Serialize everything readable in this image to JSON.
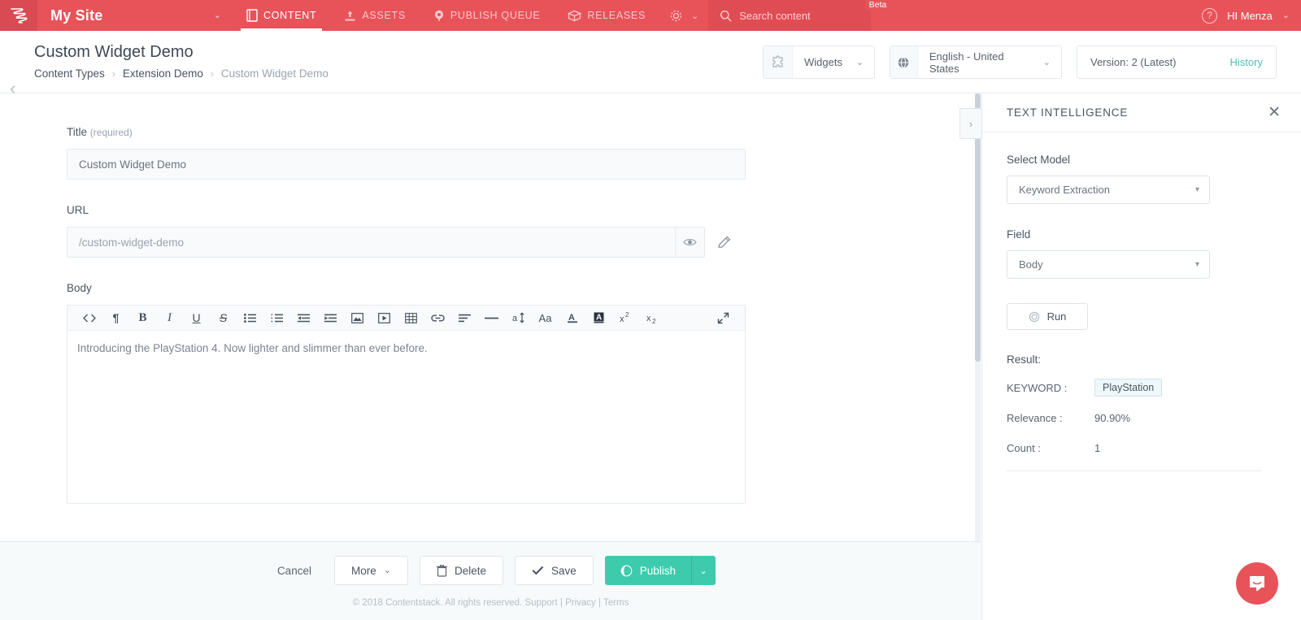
{
  "topnav": {
    "logo": "contentstack-logo-icon",
    "site_name": "My Site",
    "site_caret": "⌄",
    "items": [
      {
        "label": "CONTENT",
        "icon": "content-icon",
        "active": true
      },
      {
        "label": "ASSETS",
        "icon": "assets-upload-icon",
        "active": false
      },
      {
        "label": "PUBLISH QUEUE",
        "icon": "publish-queue-icon",
        "active": false
      },
      {
        "label": "RELEASES",
        "icon": "releases-box-icon",
        "active": false
      }
    ],
    "settings_icon": "gear-icon",
    "settings_caret": "⌄",
    "search_placeholder": "Search content",
    "search_icon": "search-icon",
    "beta_badge": "Beta",
    "help_icon": "?",
    "user_greeting": "HI  Menza",
    "user_caret": "⌄"
  },
  "header": {
    "back_icon": "‹",
    "title": "Custom Widget Demo",
    "breadcrumb": [
      {
        "label": "Content Types",
        "current": false
      },
      {
        "label": "Extension Demo",
        "current": false
      },
      {
        "label": "Custom Widget Demo",
        "current": true
      }
    ],
    "breadcrumb_sep": "›",
    "widgets": {
      "icon": "puzzle-piece-icon",
      "label": "Widgets",
      "caret": "⌄"
    },
    "locale": {
      "icon": "globe-icon",
      "label": "English - United States",
      "caret": "⌄"
    },
    "version": {
      "text": "Version: 2 (Latest)",
      "history_label": "History"
    }
  },
  "form": {
    "title_field": {
      "label": "Title",
      "required_note": "(required)",
      "value": "Custom Widget Demo"
    },
    "url_field": {
      "label": "URL",
      "value": "/custom-widget-demo",
      "eye_icon": "eye-icon",
      "pencil_icon": "pencil-edit-icon"
    },
    "body_field": {
      "label": "Body",
      "content": "Introducing the PlayStation 4. Now lighter and slimmer than ever before.",
      "toolbar": [
        {
          "name": "code-icon",
          "glyph": "<>"
        },
        {
          "name": "paragraph-mark-icon",
          "glyph": "¶"
        },
        {
          "name": "bold-icon",
          "glyph": "B"
        },
        {
          "name": "italic-icon",
          "glyph": "I"
        },
        {
          "name": "underline-icon",
          "glyph": "U"
        },
        {
          "name": "strikethrough-icon",
          "glyph": "S"
        },
        {
          "name": "bulleted-list-icon",
          "glyph": ""
        },
        {
          "name": "numbered-list-icon",
          "glyph": ""
        },
        {
          "name": "outdent-icon",
          "glyph": ""
        },
        {
          "name": "indent-icon",
          "glyph": ""
        },
        {
          "name": "insert-image-icon",
          "glyph": ""
        },
        {
          "name": "insert-video-icon",
          "glyph": ""
        },
        {
          "name": "insert-table-icon",
          "glyph": ""
        },
        {
          "name": "insert-link-icon",
          "glyph": ""
        },
        {
          "name": "align-text-icon",
          "glyph": ""
        },
        {
          "name": "horizontal-rule-icon",
          "glyph": ""
        },
        {
          "name": "line-height-icon",
          "glyph": "a"
        },
        {
          "name": "font-size-icon",
          "glyph": "Aa"
        },
        {
          "name": "text-color-icon",
          "glyph": "A"
        },
        {
          "name": "highlight-color-icon",
          "glyph": "A"
        },
        {
          "name": "superscript-icon",
          "glyph": "x"
        },
        {
          "name": "subscript-icon",
          "glyph": "x"
        }
      ],
      "expand_icon": "expand-fullscreen-icon"
    }
  },
  "sidebar": {
    "collapse_icon": "›",
    "title": "TEXT INTELLIGENCE",
    "close_icon": "✕",
    "model_label": "Select Model",
    "model_value": "Keyword Extraction",
    "field_label": "Field",
    "field_value": "Body",
    "run_label": "Run",
    "run_icon": "run-gear-icon",
    "result_label": "Result:",
    "results": [
      {
        "key": "KEYWORD :",
        "value": "PlayStation",
        "is_chip": true
      },
      {
        "key": "Relevance :",
        "value": "90.90%",
        "is_chip": false
      },
      {
        "key": "Count :",
        "value": "1",
        "is_chip": false
      }
    ],
    "select_caret": "▾"
  },
  "footer": {
    "cancel_label": "Cancel",
    "more_label": "More",
    "more_caret": "⌄",
    "delete_label": "Delete",
    "delete_icon": "trash-icon",
    "save_label": "Save",
    "save_icon": "check-icon",
    "publish_label": "Publish",
    "publish_icon": "publish-globe-icon",
    "publish_caret": "⌄",
    "copyright": "© 2018 Contentstack. All rights reserved.",
    "support_link": "Support",
    "privacy_link": "Privacy",
    "terms_link": "Terms",
    "link_sep": "|"
  },
  "chat": {
    "icon": "chat-bubble-icon"
  },
  "colors": {
    "brand_red": "#e8535a",
    "brand_red_dark": "#d94a52",
    "accent_teal": "#3ecbad",
    "history_teal": "#4ec1b6",
    "text_dark": "#4b5563",
    "text_muted": "#9aa3ae",
    "border": "#e4eaef"
  }
}
